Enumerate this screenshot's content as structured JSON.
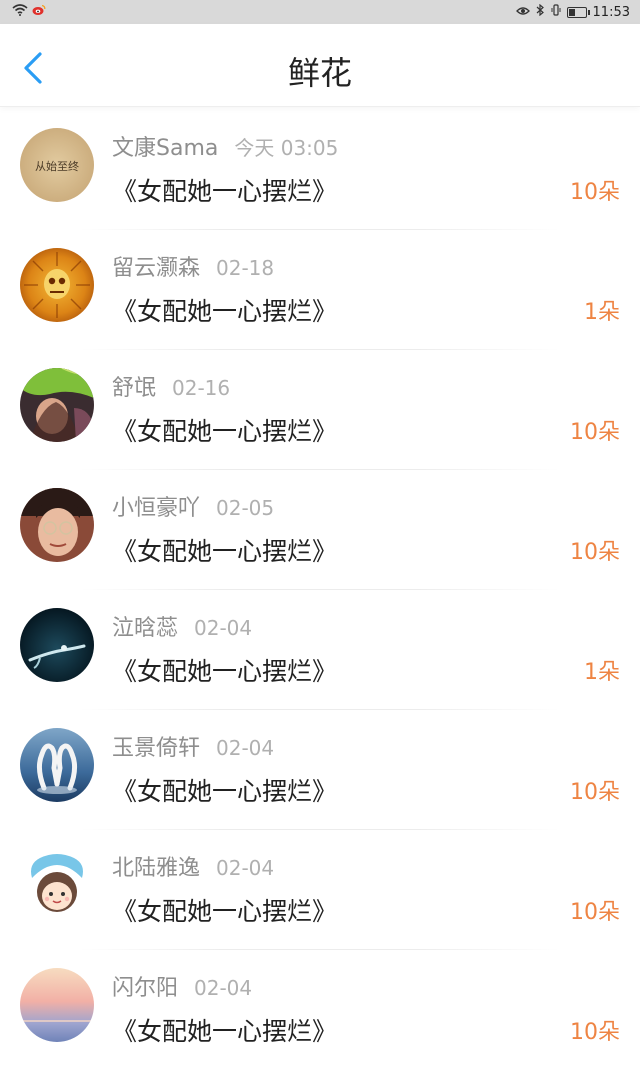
{
  "statusbar": {
    "time": "11:53"
  },
  "header": {
    "title": "鲜花",
    "back_icon": "chevron-left-icon",
    "accent": "#2a9df4"
  },
  "colors": {
    "count": "#ee8443",
    "username": "#8e8e8e",
    "date": "#b0b0b0"
  },
  "items": [
    {
      "user": "文康Sama",
      "date": "今天 03:05",
      "book": "《女配她一心摆烂》",
      "count": "10朵"
    },
    {
      "user": "留云灏森",
      "date": "02-18",
      "book": "《女配她一心摆烂》",
      "count": "1朵"
    },
    {
      "user": "舒氓",
      "date": "02-16",
      "book": "《女配她一心摆烂》",
      "count": "10朵"
    },
    {
      "user": "小恒豪吖",
      "date": "02-05",
      "book": "《女配她一心摆烂》",
      "count": "10朵"
    },
    {
      "user": "泣晗蕊",
      "date": "02-04",
      "book": "《女配她一心摆烂》",
      "count": "1朵"
    },
    {
      "user": "玉景倚轩",
      "date": "02-04",
      "book": "《女配她一心摆烂》",
      "count": "10朵"
    },
    {
      "user": "北陆雅逸",
      "date": "02-04",
      "book": "《女配她一心摆烂》",
      "count": "10朵"
    },
    {
      "user": "闪尔阳",
      "date": "02-04",
      "book": "《女配她一心摆烂》",
      "count": "10朵"
    }
  ],
  "avatars": {
    "0": {
      "text": "从始至终"
    }
  }
}
